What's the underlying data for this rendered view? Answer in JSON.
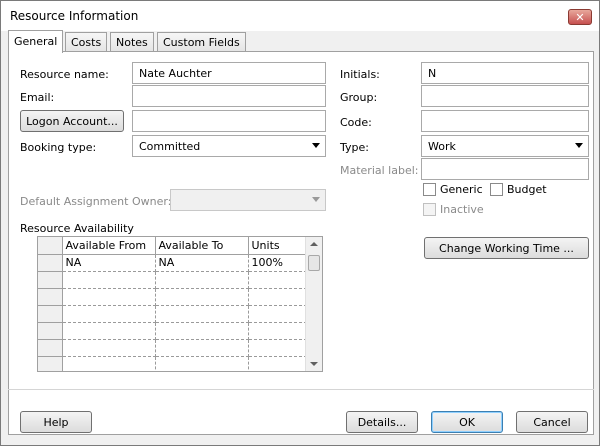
{
  "window": {
    "title": "Resource Information",
    "close_glyph": "✕"
  },
  "tabs": [
    {
      "label": "General",
      "active": true
    },
    {
      "label": "Costs"
    },
    {
      "label": "Notes"
    },
    {
      "label": "Custom Fields"
    }
  ],
  "form": {
    "resource_name": {
      "label": "Resource name:",
      "value": "Nate Auchter"
    },
    "email": {
      "label": "Email:",
      "value": ""
    },
    "logon_account_button": "Logon Account...",
    "logon_account_value": "",
    "booking_type": {
      "label": "Booking type:",
      "value": "Committed"
    },
    "default_assignment_owner": {
      "label": "Default Assignment Owner:",
      "value": ""
    },
    "initials": {
      "label": "Initials:",
      "value": "N"
    },
    "group": {
      "label": "Group:",
      "value": ""
    },
    "code": {
      "label": "Code:",
      "value": ""
    },
    "type": {
      "label": "Type:",
      "value": "Work"
    },
    "material_label": {
      "label": "Material label:",
      "value": ""
    },
    "generic": {
      "label": "Generic",
      "checked": false
    },
    "budget": {
      "label": "Budget",
      "checked": false
    },
    "inactive": {
      "label": "Inactive",
      "checked": false
    },
    "change_working_time_button": "Change Working Time ..."
  },
  "availability": {
    "label": "Resource Availability",
    "columns": [
      "Available From",
      "Available To",
      "Units"
    ],
    "rows": [
      [
        "NA",
        "NA",
        "100%"
      ],
      [
        "",
        "",
        ""
      ],
      [
        "",
        "",
        ""
      ],
      [
        "",
        "",
        ""
      ],
      [
        "",
        "",
        ""
      ],
      [
        "",
        "",
        ""
      ],
      [
        "",
        "",
        ""
      ]
    ]
  },
  "footer": {
    "help": "Help",
    "details": "Details...",
    "ok": "OK",
    "cancel": "Cancel"
  },
  "icons": {
    "dropdown": "chevron-down-icon",
    "close": "close-icon"
  }
}
